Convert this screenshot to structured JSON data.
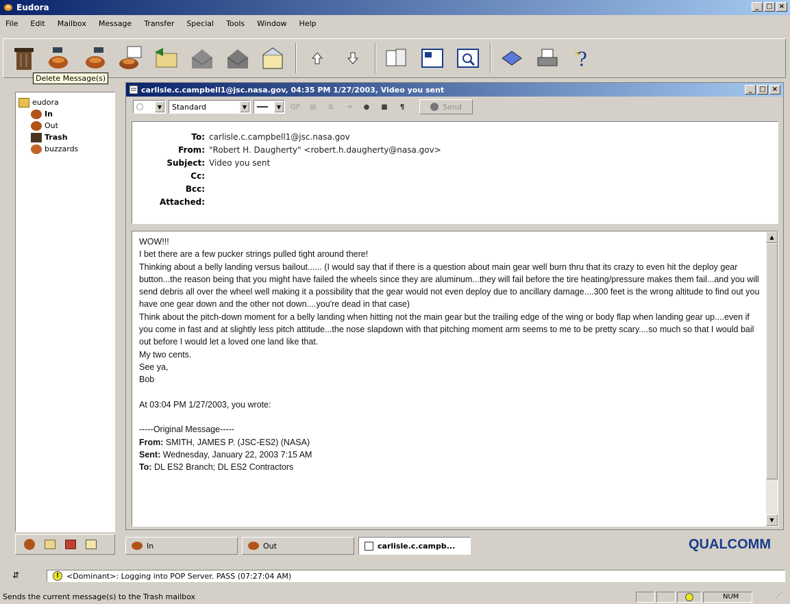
{
  "app": {
    "title": "Eudora"
  },
  "menu": [
    "File",
    "Edit",
    "Mailbox",
    "Message",
    "Transfer",
    "Special",
    "Tools",
    "Window",
    "Help"
  ],
  "tooltip": "Delete Message(s)",
  "mailboxes": {
    "root": "eudora",
    "items": [
      {
        "label": "In",
        "bold": true
      },
      {
        "label": "Out",
        "bold": false
      },
      {
        "label": "Trash",
        "bold": true
      },
      {
        "label": "buzzards",
        "bold": false
      }
    ]
  },
  "message_window": {
    "title": "carlisle.c.campbell1@jsc.nasa.gov, 04:35 PM 1/27/2003, Video you sent",
    "style_combo": "Standard",
    "send_label": "Send"
  },
  "headers": {
    "to_label": "To:",
    "to": "carlisle.c.campbell1@jsc.nasa.gov",
    "from_label": "From:",
    "from": "\"Robert H. Daugherty\" <robert.h.daugherty@nasa.gov>",
    "subject_label": "Subject:",
    "subject": "Video you sent",
    "cc_label": "Cc:",
    "cc": "",
    "bcc_label": "Bcc:",
    "bcc": "",
    "attached_label": "Attached:",
    "attached": ""
  },
  "body": {
    "lines": [
      "WOW!!!",
      "I bet there are a few pucker strings pulled tight around there!",
      "Thinking about a belly landing versus bailout...... (I would say that if there is  a question about main gear well burn thru that its crazy to even hit the deploy gear button...the reason being that you might have failed the wheels since they are aluminum...they will fail before the tire heating/pressure makes them fail...and you will send debris all over the wheel well making it a possibility that the gear would not even deploy due to ancillary damage....300 feet is the wrong altitude to find out you have one gear down and the other not down....you're dead in that case)",
      "Think about the pitch-down moment for a belly landing when hitting not the main gear but the trailing edge of the wing or body flap when landing gear up....even if you come in fast and at slightly less pitch attitude...the nose slapdown with that pitching moment arm seems to me to be pretty scary....so much so that I would bail out before I would let a loved one land like that.",
      "My two cents.",
      "See ya,",
      "Bob",
      "",
      "At 03:04 PM 1/27/2003, you wrote:",
      "",
      "-----Original Message-----"
    ],
    "orig_from_label": "From:",
    "orig_from": "SMITH, JAMES P. (JSC-ES2) (NASA)",
    "orig_sent_label": "Sent:",
    "orig_sent": "Wednesday, January 22, 2003 7:15 AM",
    "orig_to_label": "To:",
    "orig_to": "DL ES2 Branch; DL ES2 Contractors"
  },
  "task_tabs": [
    {
      "label": "In",
      "active": false
    },
    {
      "label": "Out",
      "active": false
    },
    {
      "label": "carlisle.c.campb...",
      "active": true
    }
  ],
  "brand": "QUALCOMM",
  "task_status": "<Dominant>: Logging into POP Server. PASS (07:27:04 AM)",
  "status": {
    "text": "Sends the current message(s) to the Trash mailbox",
    "num": "NUM"
  },
  "colors": {
    "titlebar_start": "#0a246a",
    "titlebar_end": "#a6caf0",
    "brand": "#1a3c8c"
  }
}
